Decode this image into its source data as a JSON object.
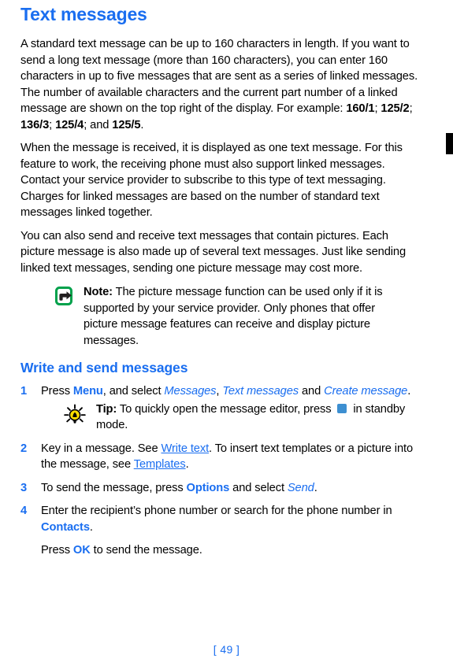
{
  "document": {
    "chapter_title": "Text messages",
    "page_number": "[ 49 ]"
  },
  "paragraphs": {
    "p1_part1": "A standard text message can be up to 160 characters in length.  If you want to send a long text message (more than 160 characters), you can enter 160 characters in up to five messages that are sent as a series of linked messages. The number of available characters and the current part number of a linked message are shown on the top right of the display. For example:  ",
    "p1_num1": "160/1",
    "p1_sep1": "; ",
    "p1_num2": "125/2",
    "p1_sep2": "; ",
    "p1_num3": "136/3",
    "p1_sep3": "; ",
    "p1_num4": "125/4",
    "p1_sep4": "; and ",
    "p1_num5": "125/5",
    "p1_end": ".",
    "p2": "When the message is received, it is displayed as one text message.  For this feature to work, the receiving phone must also support linked messages.  Contact your service provider to subscribe to this type of text messaging.  Charges for linked messages are based on the number of standard text messages linked together.",
    "p3": "You can also send and receive text messages that contain pictures. Each picture message is also made up of several text messages. Just like sending linked text messages, sending one picture message may cost more."
  },
  "note": {
    "label": "Note:",
    "text": " The picture message function can be used only if it is supported by your service provider. Only phones that offer picture message features can receive and display picture messages.",
    "icon": "note-arrow-icon",
    "icon_border_color": "#00a14b",
    "icon_arrow_color": "#231f20"
  },
  "section": {
    "title": "Write and send messages"
  },
  "steps": [
    {
      "number": "1",
      "text_before": "Press ",
      "kw1": "Menu",
      "text_mid1": ", and select ",
      "item1": "Messages",
      "text_mid2": ", ",
      "item2": "Text messages",
      "text_mid3": " and ",
      "item3": "Create message",
      "text_end": "."
    },
    {
      "number": "2",
      "text_before": "Key in a message. See ",
      "link1": "Write text",
      "text_mid1": ". To insert text templates or a picture into the message, see ",
      "link2": "Templates",
      "text_end": "."
    },
    {
      "number": "3",
      "text_before": "To send the message, press ",
      "kw1": "Options",
      "text_mid1": " and select ",
      "item1": "Send",
      "text_end": "."
    },
    {
      "number": "4",
      "text_before": "Enter the recipient’s phone number or search for the phone number in ",
      "kw1": "Contacts",
      "text_end": ".",
      "continuation_before": "Press ",
      "continuation_kw": "OK",
      "continuation_end": " to send the message."
    }
  ],
  "tip": {
    "label": "Tip:",
    "text_before": " To quickly open the message editor, press ",
    "key_glyph": "navi-key-icon",
    "key_glyph_color": "#3d8fd1",
    "text_after": " in standby mode.",
    "icon": "lightbulb-icon",
    "icon_bulb_color": "#ffde00",
    "icon_ray_color": "#000000"
  }
}
